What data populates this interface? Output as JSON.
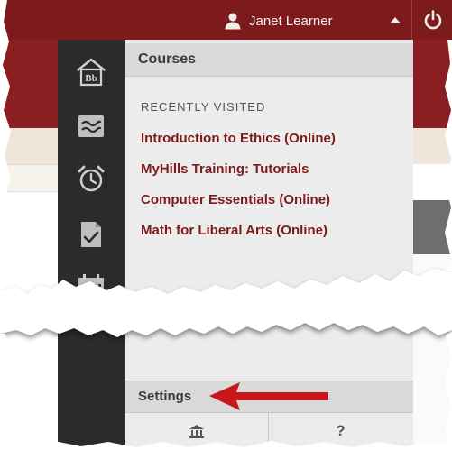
{
  "topbar": {
    "user_name": "Janet Learner",
    "avatar_icon": "user-silhouette-icon",
    "menu_icon": "caret-up-icon",
    "logout_icon": "power-icon"
  },
  "rail": {
    "items": [
      {
        "name": "rail-institution-page",
        "icon": "bb-home-icon",
        "glyph": "Bb"
      },
      {
        "name": "rail-activity-stream",
        "icon": "waves-icon"
      },
      {
        "name": "rail-due-dates",
        "icon": "alarm-clock-icon"
      },
      {
        "name": "rail-grades",
        "icon": "checked-document-icon"
      },
      {
        "name": "rail-calendar",
        "icon": "calendar-icon"
      }
    ]
  },
  "panel": {
    "title": "Courses",
    "section_label": "RECENTLY VISITED",
    "courses": [
      "Introduction to Ethics (Online)",
      "MyHills Training: Tutorials",
      "Computer Essentials (Online)",
      "Math for Liberal Arts (Online)"
    ],
    "settings_label": "Settings",
    "bottom_left_icon": "institution-icon",
    "bottom_right_glyph": "?"
  },
  "colors": {
    "brand_red": "#7c1a1c",
    "rail_dark": "#2b2b2b",
    "panel_bg": "#ececec",
    "header_bg": "#d9d9d9",
    "arrow_red": "#c8161d"
  }
}
